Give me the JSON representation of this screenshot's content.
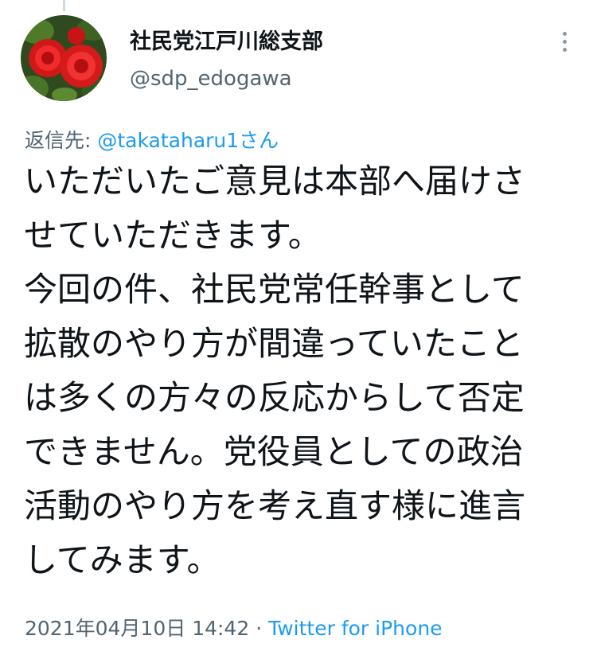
{
  "tweet": {
    "author": {
      "display_name": "社民党江戸川総支部",
      "handle": "@sdp_edogawa",
      "avatar_icon": "red-rose-avatar"
    },
    "menu_icon": "more-vertical-icon",
    "reply": {
      "prefix": "返信先: ",
      "mention": "@takataharu1",
      "suffix": "さん"
    },
    "body_lines": [
      "いただいたご意見は本部へ届けさ",
      "せていただきます。",
      "今回の件、社民党常任幹事として",
      "拡散のやり方が間違っていたこと",
      "は多くの方々の反応からして否定",
      "できません。党役員としての政治",
      "活動のやり方を考え直す様に進言",
      "してみます。"
    ],
    "timestamp": "2021年04月10日 14:42",
    "separator": " · ",
    "source": "Twitter for iPhone"
  },
  "colors": {
    "text": "#0f1419",
    "secondary": "#536471",
    "link": "#1d9bf0"
  }
}
